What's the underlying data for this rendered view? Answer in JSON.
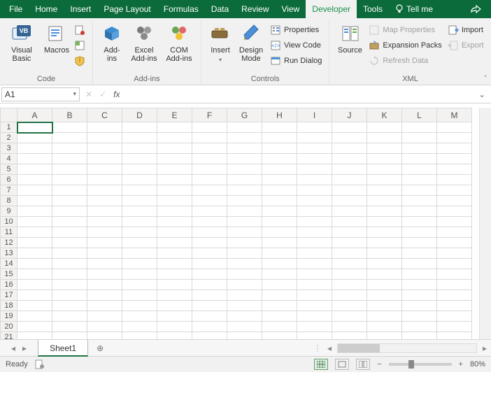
{
  "tabs": {
    "file": "File",
    "home": "Home",
    "insert": "Insert",
    "pagelayout": "Page Layout",
    "formulas": "Formulas",
    "data": "Data",
    "review": "Review",
    "view": "View",
    "developer": "Developer",
    "tools": "Tools",
    "tellme": "Tell me"
  },
  "ribbon": {
    "code": {
      "label": "Code",
      "visual_basic": "Visual\nBasic",
      "macros": "Macros"
    },
    "addins": {
      "label": "Add-ins",
      "addins": "Add-\nins",
      "excel_addins": "Excel\nAdd-ins",
      "com_addins": "COM\nAdd-ins"
    },
    "controls": {
      "label": "Controls",
      "insert": "Insert",
      "design_mode": "Design\nMode",
      "properties": "Properties",
      "view_code": "View Code",
      "run_dialog": "Run Dialog"
    },
    "xml": {
      "label": "XML",
      "source": "Source",
      "map_properties": "Map Properties",
      "expansion_packs": "Expansion Packs",
      "refresh_data": "Refresh Data",
      "import": "Import",
      "export": "Export"
    }
  },
  "namebox": {
    "value": "A1"
  },
  "fx": {
    "label": "fx"
  },
  "columns": [
    "A",
    "B",
    "C",
    "D",
    "E",
    "F",
    "G",
    "H",
    "I",
    "J",
    "K",
    "L",
    "M"
  ],
  "rows": [
    "1",
    "2",
    "3",
    "4",
    "5",
    "6",
    "7",
    "8",
    "9",
    "10",
    "11",
    "12",
    "13",
    "14",
    "15",
    "16",
    "17",
    "18",
    "19",
    "20",
    "21"
  ],
  "sheet": {
    "name": "Sheet1"
  },
  "status": {
    "ready": "Ready",
    "zoom": "80%"
  }
}
